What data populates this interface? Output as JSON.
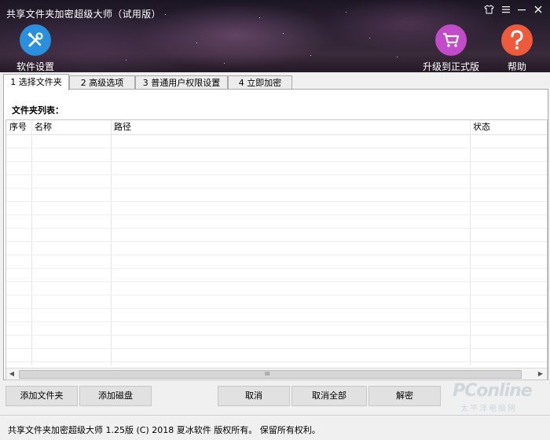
{
  "window": {
    "title": "共享文件夹加密超级大师（试用版）",
    "controls": {
      "skin": "shirt-icon",
      "menu": "menu-icon",
      "minimize": "minimize-icon",
      "close": "close-icon"
    }
  },
  "header": {
    "settings_label": "软件设置",
    "upgrade_label": "升级到正式版",
    "help_label": "帮助",
    "colors": {
      "settings": "#2a8fdc",
      "upgrade": "#c24bc9",
      "help": "#ee5a3c"
    }
  },
  "tabs": [
    {
      "label": "1 选择文件夹",
      "active": true
    },
    {
      "label": "2 高级选项",
      "active": false
    },
    {
      "label": "3 普通用户权限设置",
      "active": false
    },
    {
      "label": "4 立即加密",
      "active": false
    }
  ],
  "panel": {
    "list_label": "文件夹列表：",
    "columns": [
      "序号",
      "名称",
      "路径",
      "状态"
    ],
    "scroll_grip": "III"
  },
  "buttons": {
    "add_folder": "添加文件夹",
    "add_disk": "添加磁盘",
    "cancel": "取消",
    "cancel_all": "取消全部",
    "decrypt": "解密"
  },
  "status": {
    "text": "共享文件夹加密超级大师 1.25版 (C) 2018 夏冰软件 版权所有。 保留所有权利。"
  },
  "watermark": {
    "brand": "PConline",
    "sub": "太平洋电脑网"
  }
}
